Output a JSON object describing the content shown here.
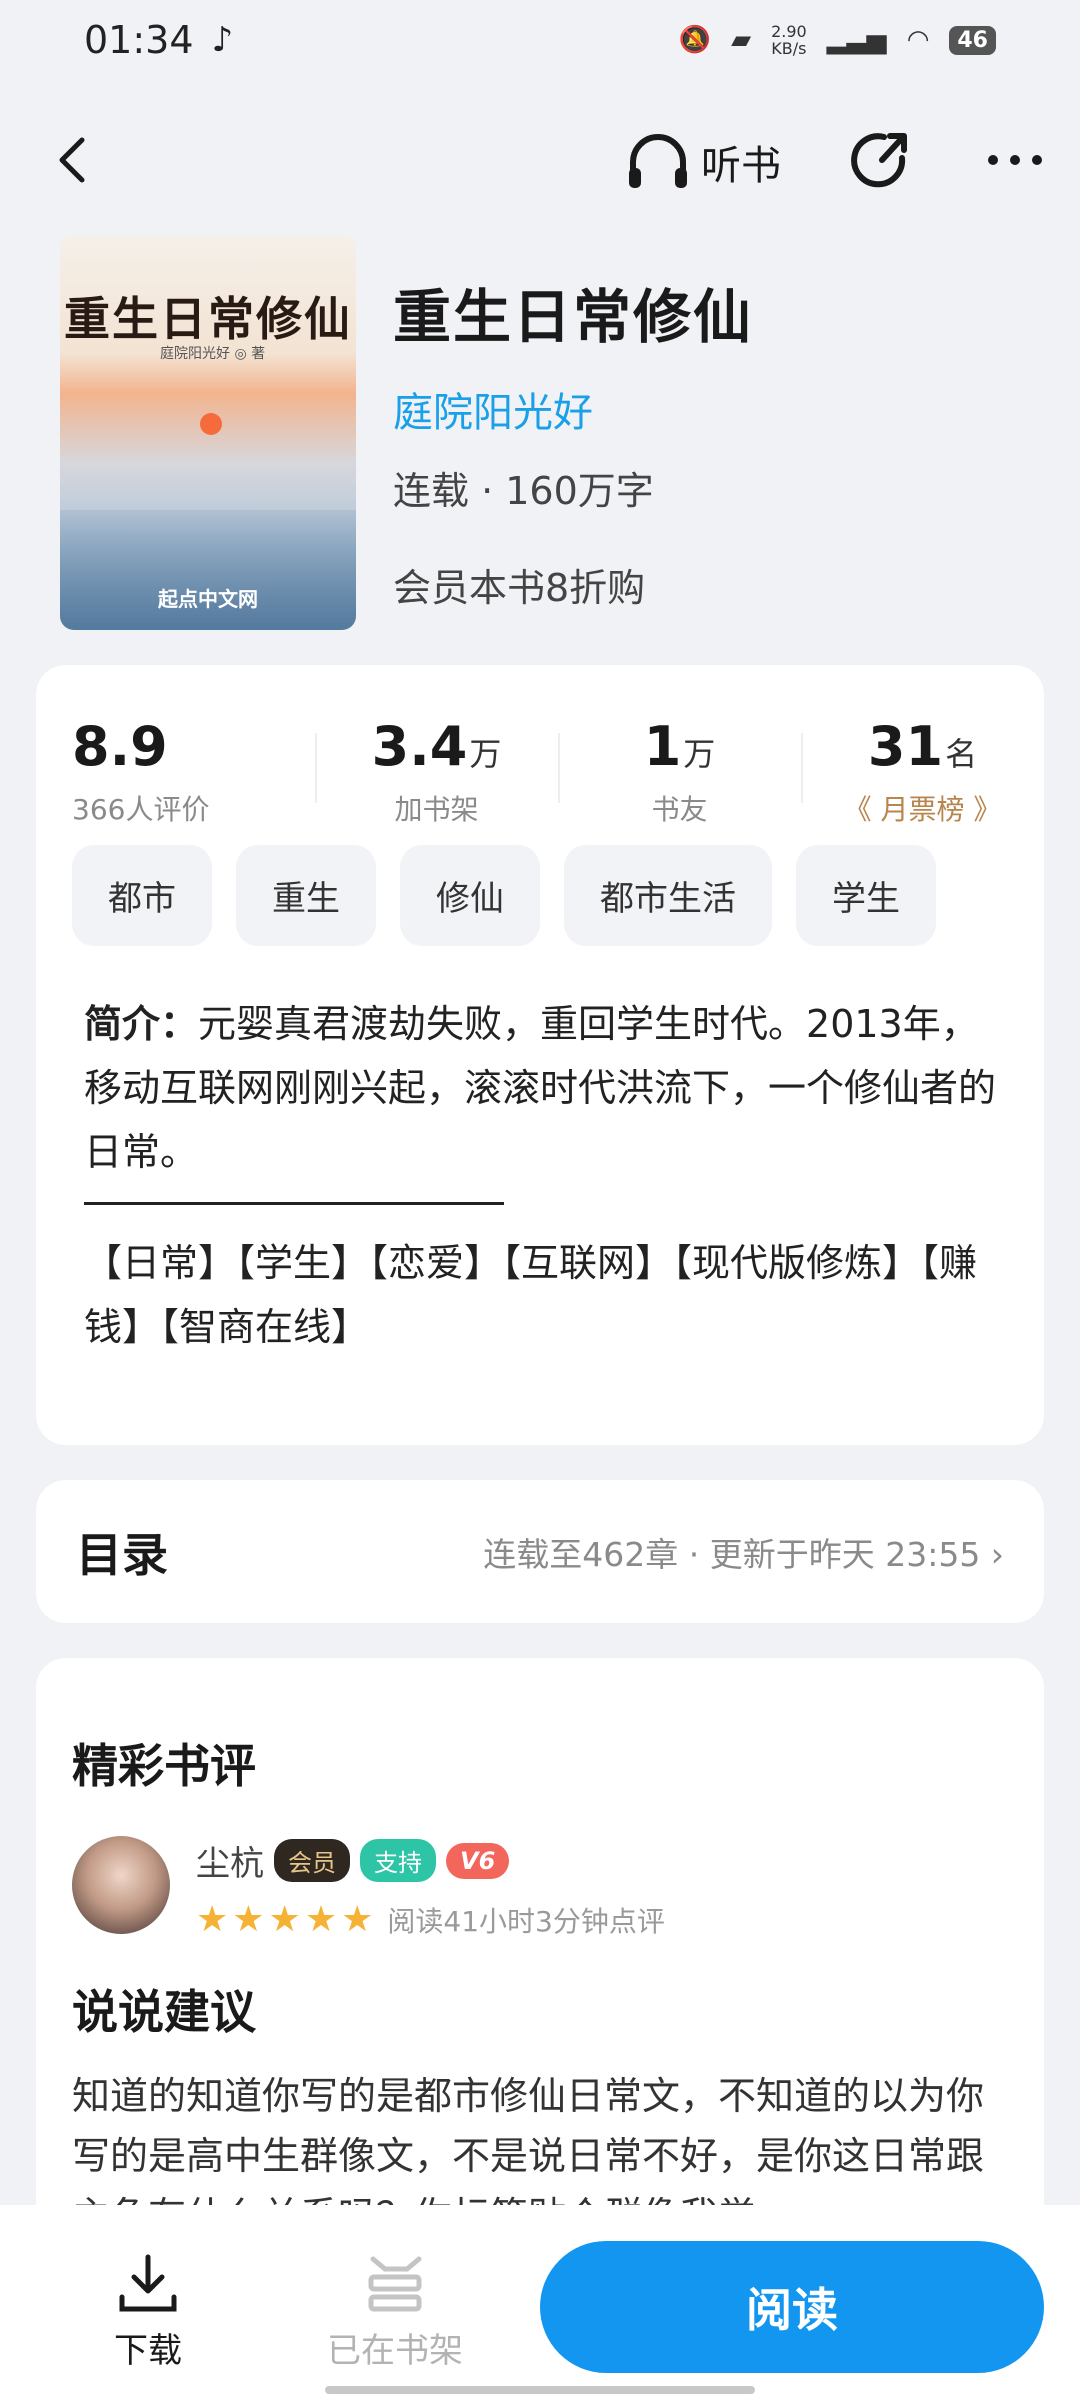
{
  "status_bar": {
    "time": "01:34",
    "net_speed_value": "2.90",
    "net_speed_unit": "KB/s",
    "battery": "46"
  },
  "header": {
    "listen_label": "听书"
  },
  "book": {
    "cover_title": "重生日常修仙",
    "cover_author": "庭院阳光好 ◎ 著",
    "cover_publisher": "起点中文网",
    "title": "重生日常修仙",
    "author": "庭院阳光好",
    "meta": "连载 · 160万字",
    "promo": "会员本书8折购"
  },
  "stats": [
    {
      "num": "8.9",
      "unit": "",
      "label": "366人评价"
    },
    {
      "num": "3.4",
      "unit": "万",
      "label": "加书架"
    },
    {
      "num": "1",
      "unit": "万",
      "label": "书友"
    },
    {
      "num": "31",
      "unit": "名",
      "label": "《 月票榜 》"
    }
  ],
  "tags": [
    "都市",
    "重生",
    "修仙",
    "都市生活",
    "学生"
  ],
  "intro": {
    "label": "简介：",
    "text": "元婴真君渡劫失败，重回学生时代。2013年，移动互联网刚刚兴起，滚滚时代洪流下，一个修仙者的日常。",
    "keywords": "【日常】【学生】【恋爱】【互联网】【现代版修炼】【赚钱】【智商在线】"
  },
  "toc": {
    "label": "目录",
    "update": "连载至462章 · 更新于昨天 23:55 ›"
  },
  "reviews": {
    "section_title": "精彩书评",
    "item": {
      "username": "尘杭",
      "badge_vip": "会员",
      "badge_support": "支持",
      "badge_level": "V6",
      "stars": "★★★★★",
      "read_time": "阅读41小时3分钟点评",
      "title": "说说建议",
      "body": "知道的知道你写的是都市修仙日常文，不知道的以为你写的是高中生群像文，不是说日常不好，是你这日常跟主角有什么关系吗？你标签贴个群像我觉"
    }
  },
  "bottom": {
    "download": "下载",
    "shelf": "已在书架",
    "read": "阅读"
  }
}
